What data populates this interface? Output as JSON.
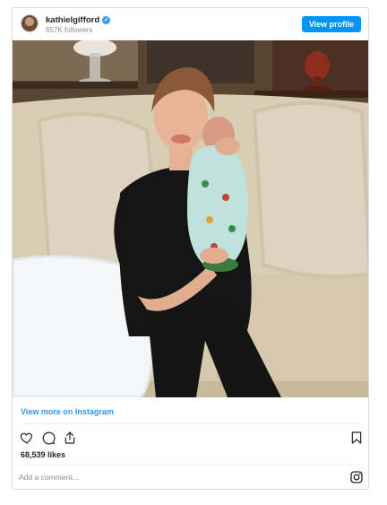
{
  "header": {
    "username": "kathielgifford",
    "verified_mark": "✓",
    "followers": "657K followers",
    "view_profile_label": "View profile"
  },
  "post": {
    "image_alt": "Kathie Lee Gifford holding a baby on a sofa",
    "view_more_label": "View more on Instagram",
    "likes": "68,539 likes"
  },
  "actions": {
    "icons": [
      "heart-icon",
      "comment-icon",
      "share-icon",
      "bookmark-icon",
      "instagram-icon"
    ]
  },
  "comment": {
    "placeholder": "Add a comment..."
  },
  "colors": {
    "accent": "#0095f6",
    "link": "#3897f0",
    "text": "#262626",
    "muted": "#8e8e8e",
    "border": "#dbdbdb"
  }
}
